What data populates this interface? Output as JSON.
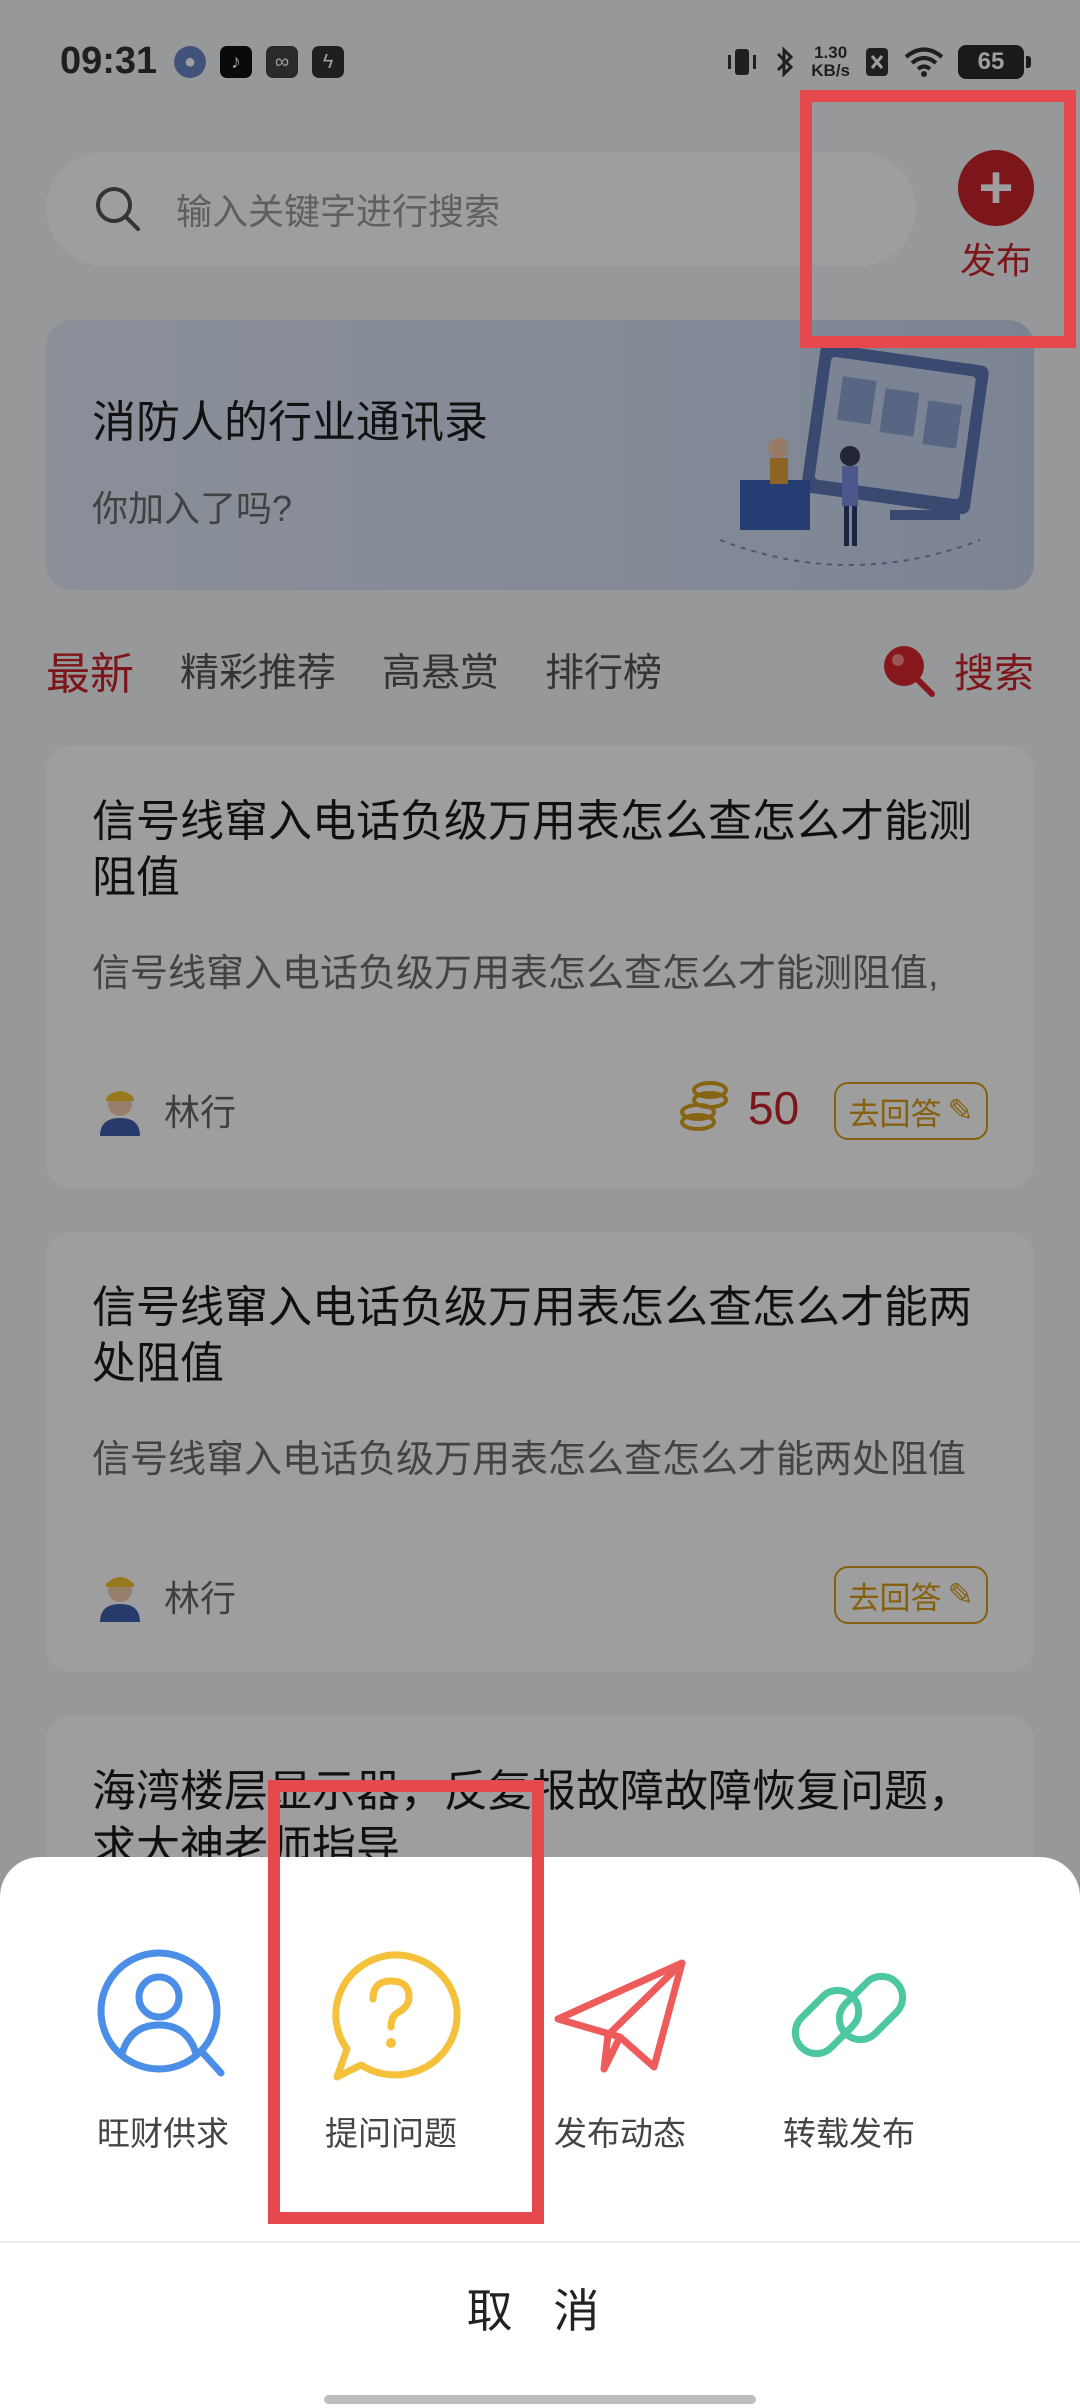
{
  "status_bar": {
    "time": "09:31",
    "net_speed_value": "1.30",
    "net_speed_unit": "KB/s",
    "battery": "65"
  },
  "search": {
    "placeholder": "输入关键字进行搜索"
  },
  "publish": {
    "label": "发布",
    "accent": "#c8242b"
  },
  "banner": {
    "title": "消防人的行业通讯录",
    "subtitle": "你加入了吗?"
  },
  "tabs": [
    {
      "label": "最新",
      "active": true
    },
    {
      "label": "精彩推荐",
      "active": false
    },
    {
      "label": "高悬赏",
      "active": false
    },
    {
      "label": "排行榜",
      "active": false
    }
  ],
  "tab_search_label": "搜索",
  "posts": [
    {
      "title": "信号线窜入电话负级万用表怎么查怎么才能测阻值",
      "excerpt": "信号线窜入电话负级万用表怎么查怎么才能测阻值,",
      "author": "林行",
      "reward": "50",
      "answer_label": "去回答"
    },
    {
      "title": "信号线窜入电话负级万用表怎么查怎么才能两处阻值",
      "excerpt": "信号线窜入电话负级万用表怎么查怎么才能两处阻值",
      "author": "林行",
      "answer_label": "去回答"
    },
    {
      "title": "海湾楼层显示器，反复报故障故障恢复问题，求大神老师指导"
    }
  ],
  "sheet": {
    "options": [
      {
        "label": "旺财供求",
        "icon": "user-search-icon",
        "color": "#4a8ee8"
      },
      {
        "label": "提问问题",
        "icon": "question-bubble-icon",
        "color": "#f5c03a"
      },
      {
        "label": "发布动态",
        "icon": "paper-plane-icon",
        "color": "#ee5b5b"
      },
      {
        "label": "转载发布",
        "icon": "link-icon",
        "color": "#4cc7a0"
      }
    ],
    "cancel_label": "取 消"
  },
  "highlight_color": "#e5484d"
}
